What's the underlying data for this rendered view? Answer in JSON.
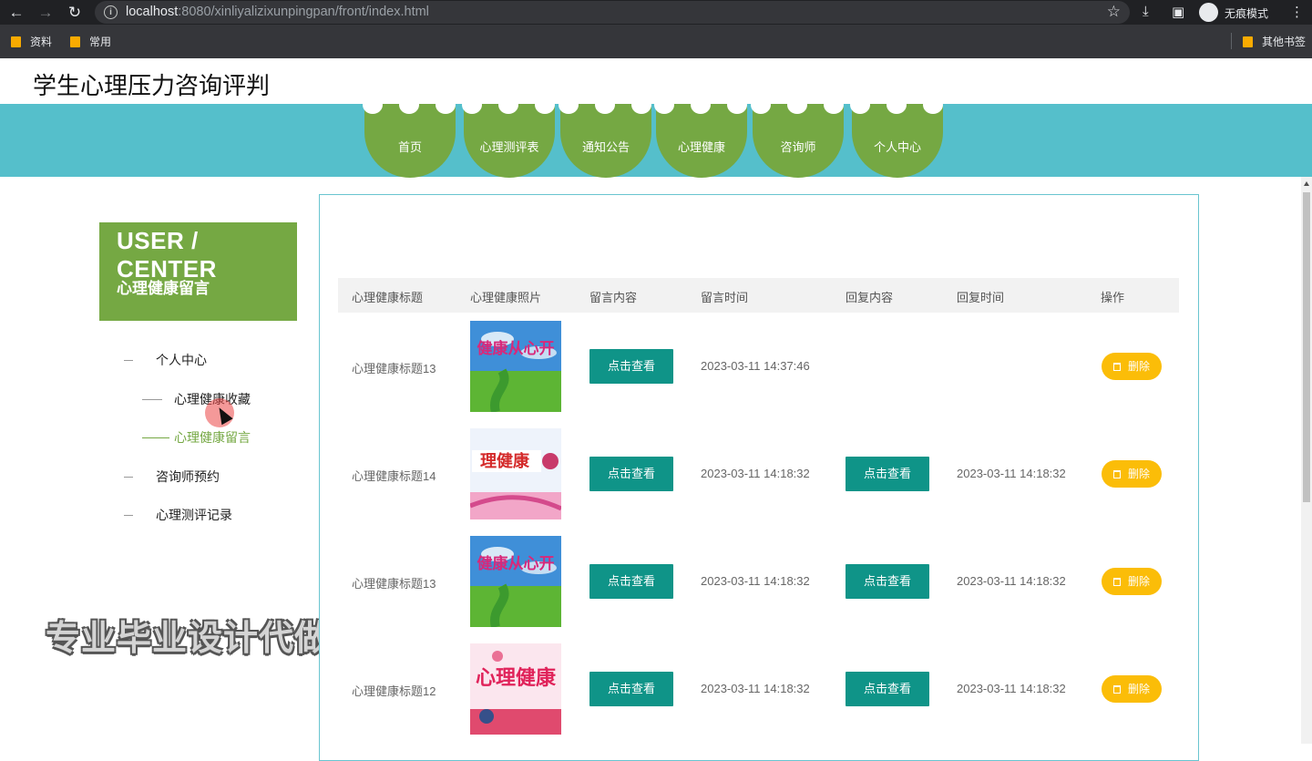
{
  "browser": {
    "url_host": "localhost",
    "url_rest": ":8080/xinliyalizixunpingpan/front/index.html",
    "incognito_label": "无痕模式",
    "bookmarks": [
      "资料",
      "常用"
    ],
    "other_bookmarks": "其他书签"
  },
  "site": {
    "title": "学生心理压力咨询评判",
    "nav": [
      "首页",
      "心理测评表",
      "通知公告",
      "心理健康",
      "咨询师",
      "个人中心"
    ]
  },
  "sidebar": {
    "title": "USER / CENTER",
    "subtitle": "心理健康留言",
    "items": [
      {
        "label": "个人中心"
      },
      {
        "label": "心理健康收藏"
      },
      {
        "label": "心理健康留言"
      },
      {
        "label": "咨询师预约"
      },
      {
        "label": "心理测评记录"
      }
    ]
  },
  "watermark": "专业毕业设计代做",
  "table": {
    "headers": [
      "心理健康标题",
      "心理健康照片",
      "留言内容",
      "留言时间",
      "回复内容",
      "回复时间",
      "操作"
    ],
    "rows": [
      {
        "title": "心理健康标题13",
        "photo_text": "健康从心开",
        "view": "点击查看",
        "time": "2023-03-11 14:37:46",
        "reply_view": "",
        "reply_time": "",
        "del": "删除"
      },
      {
        "title": "心理健康标题14",
        "photo_text": "理健康",
        "view": "点击查看",
        "time": "2023-03-11 14:18:32",
        "reply_view": "点击查看",
        "reply_time": "2023-03-11 14:18:32",
        "del": "删除"
      },
      {
        "title": "心理健康标题13",
        "photo_text": "健康从心开",
        "view": "点击查看",
        "time": "2023-03-11 14:18:32",
        "reply_view": "点击查看",
        "reply_time": "2023-03-11 14:18:32",
        "del": "删除"
      },
      {
        "title": "心理健康标题12",
        "photo_text": "心理健康",
        "view": "点击查看",
        "time": "2023-03-11 14:18:32",
        "reply_view": "点击查看",
        "reply_time": "2023-03-11 14:18:32",
        "del": "删除"
      }
    ]
  },
  "colors": {
    "nav_band": "#55bfcb",
    "green": "#75a843",
    "teal_button": "#0f9488",
    "yellow_button": "#fbbd08"
  }
}
